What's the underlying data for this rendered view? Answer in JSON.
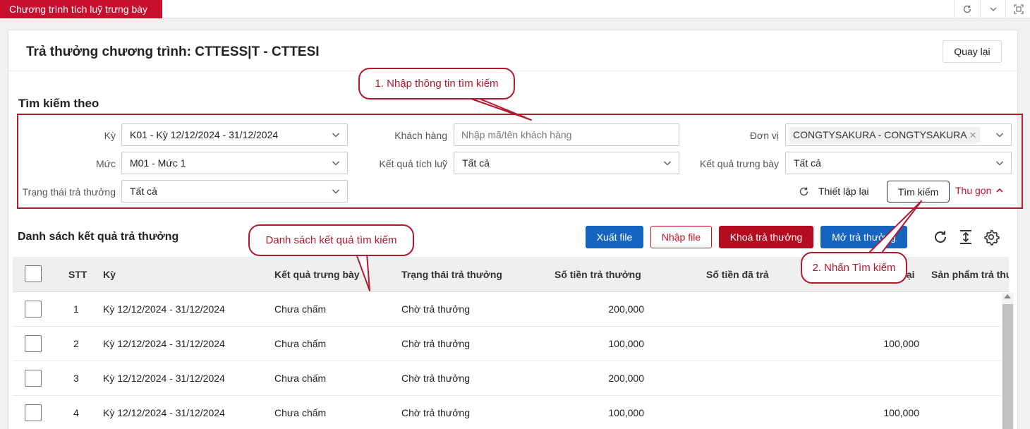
{
  "app_tab": {
    "label": "Chương trình tích luỹ trưng bày"
  },
  "page": {
    "title": "Trả thưởng chương trình: CTTESS|T - CTTESI",
    "back_label": "Quay lại"
  },
  "search": {
    "heading": "Tìm kiếm theo",
    "ky_label": "Kỳ",
    "ky_value": "K01 - Kỳ 12/12/2024 - 31/12/2024",
    "khach_hang_label": "Khách hàng",
    "khach_hang_placeholder": "Nhập mã/tên khách hàng",
    "don_vi_label": "Đơn vị",
    "don_vi_tag": "CONGTYSAKURA - CONGTYSAKURA",
    "muc_label": "Mức",
    "muc_value": "M01 - Mức 1",
    "ket_qua_tich_luy_label": "Kết quả tích luỹ",
    "ket_qua_tich_luy_value": "Tất cả",
    "ket_qua_trung_bay_label": "Kết quả trưng bày",
    "ket_qua_trung_bay_value": "Tất cả",
    "trang_thai_label": "Trạng thái trả thưởng",
    "trang_thai_value": "Tất cả",
    "reset_label": "Thiết lập lại",
    "search_button": "Tìm kiếm",
    "collapse_label": "Thu gọn"
  },
  "list": {
    "heading": "Danh sách kết quả trả thưởng",
    "export_label": "Xuất file",
    "import_label": "Nhập file",
    "lock_label": "Khoá trả thưởng",
    "unlock_label": "Mở trả thưởng"
  },
  "table": {
    "columns": [
      "STT",
      "Kỳ",
      "Kết quả trưng bày",
      "Trạng thái trả thưởng",
      "Số tiền trả thưởng",
      "Số tiền đã trả",
      "lại",
      "Sản phẩm trả thư"
    ],
    "rows": [
      {
        "stt": "1",
        "ky": "Kỳ 12/12/2024 - 31/12/2024",
        "ket_qua": "Chưa chấm",
        "trang_thai": "Chờ trả thưởng",
        "so_tien": "200,000",
        "con_lai": ""
      },
      {
        "stt": "2",
        "ky": "Kỳ 12/12/2024 - 31/12/2024",
        "ket_qua": "Chưa chấm",
        "trang_thai": "Chờ trả thưởng",
        "so_tien": "100,000",
        "con_lai": "100,000"
      },
      {
        "stt": "3",
        "ky": "Kỳ 12/12/2024 - 31/12/2024",
        "ket_qua": "Chưa chấm",
        "trang_thai": "Chờ trả thưởng",
        "so_tien": "200,000",
        "con_lai": ""
      },
      {
        "stt": "4",
        "ky": "Kỳ 12/12/2024 - 31/12/2024",
        "ket_qua": "Chưa chấm",
        "trang_thai": "Chờ trả thưởng",
        "so_tien": "100,000",
        "con_lai": "100,000"
      }
    ]
  },
  "annotations": {
    "step1": "1. Nhập thông tin tìm kiếm",
    "list_note": "Danh sách kết quả tìm kiếm",
    "step2": "2. Nhấn Tìm kiếm"
  },
  "colors": {
    "brand_red": "#c8102e",
    "primary_blue": "#1565c0",
    "dark_red": "#b40c1e"
  },
  "icons": [
    "refresh-icon",
    "chevron-down-icon",
    "maximize-icon",
    "reload-icon",
    "column-height-icon",
    "settings-icon",
    "chevron-up-icon",
    "close-icon"
  ]
}
